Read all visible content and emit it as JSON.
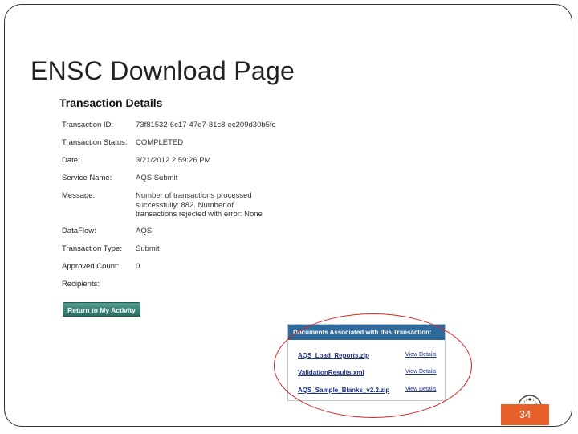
{
  "slide": {
    "title": "ENSC Download Page",
    "page_number": "34"
  },
  "transaction": {
    "heading": "Transaction Details",
    "rows": [
      {
        "label": "Transaction ID:",
        "value": "73f81532-6c17-47e7-81c8-ec209d30b5fc"
      },
      {
        "label": "Transaction Status:",
        "value": "COMPLETED"
      },
      {
        "label": "Date:",
        "value": "3/21/2012 2:59:26 PM"
      },
      {
        "label": "Service Name:",
        "value": "AQS Submit"
      },
      {
        "label": "Message:",
        "value": "Number of transactions processed successfully: 882. Number of transactions rejected with error: None"
      },
      {
        "label": "DataFlow:",
        "value": "AQS"
      },
      {
        "label": "Transaction Type:",
        "value": "Submit"
      },
      {
        "label": "Approved Count:",
        "value": "0"
      },
      {
        "label": "Recipients:",
        "value": ""
      }
    ],
    "return_button_label": "Return to My Activity"
  },
  "documents": {
    "header": "Documents Associated with this Transaction:",
    "files": [
      {
        "name": "AQS_Load_Reports.zip",
        "link": "View Details"
      },
      {
        "name": "ValidationResults.xml",
        "link": "View Details"
      },
      {
        "name": "AQS_Sample_Blanks_v2.2.zip",
        "link": "View Details"
      }
    ]
  },
  "colors": {
    "highlight_oval": "#d42626",
    "page_number_bg": "#e8612c",
    "panel_header": "#2f6a9b",
    "button": "#2c6d62"
  }
}
